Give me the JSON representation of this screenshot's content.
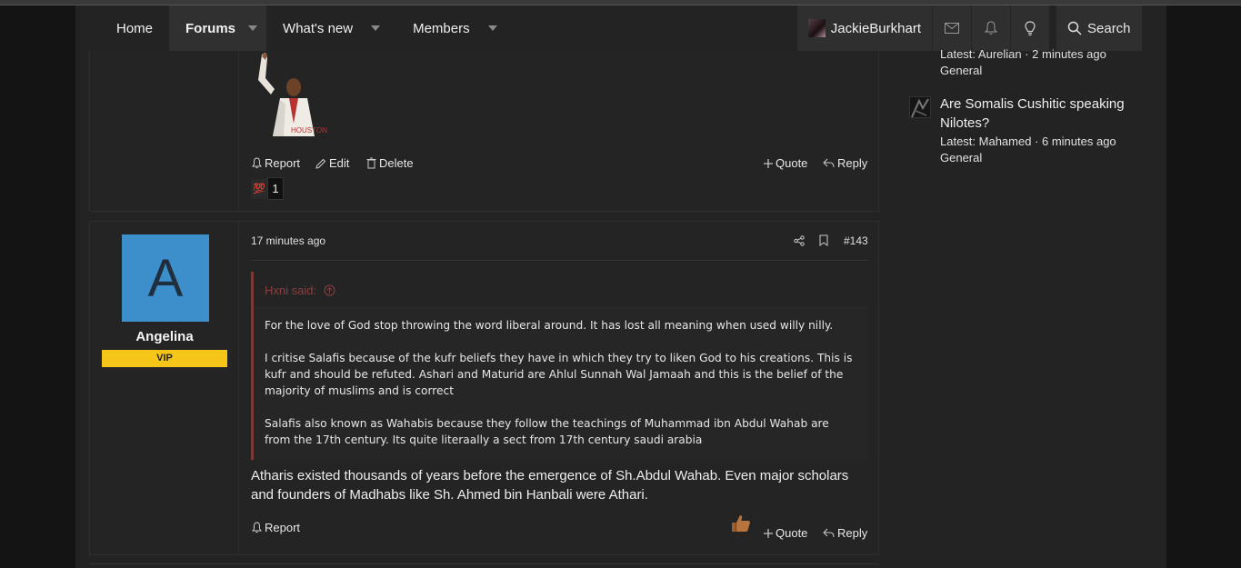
{
  "nav": {
    "home": "Home",
    "forums": "Forums",
    "whats_new": "What's new",
    "members": "Members",
    "username": "JackieBurkhart",
    "search": "Search"
  },
  "sidebar": {
    "thread1_meta": "Latest: Aurelian · 2 minutes ago",
    "thread1_forum": "General",
    "thread2_title": "Are Somalis Cushitic speaking Nilotes?",
    "thread2_meta": "Latest: Mahamed · 6 minutes ago",
    "thread2_forum": "General"
  },
  "post1": {
    "report": "Report",
    "edit": "Edit",
    "delete": "Delete",
    "quote": "Quote",
    "reply": "Reply",
    "reaction_emoji": "💯",
    "reaction_count": "1"
  },
  "post2": {
    "author_initial": "A",
    "author": "Angelina",
    "badge": "VIP",
    "time": "17 minutes ago",
    "number": "#143",
    "quote_author": "Hxni said:",
    "quote_paragraphs": [
      "For the love of God stop throwing the word liberal around. It has lost all meaning when used willy nilly.",
      "I critise Salafis because of the kufr beliefs they have in which they try to liken God to his creations. This is kufr and should be refuted. Ashari and Maturid are Ahlul Sunnah Wal Jamaah and this is the belief of the majority of muslims and is correct",
      "Salafis also known as Wahabis because they follow the teachings of Muhammad ibn Abdul Wahab are from the 17th century. Its quite literaally a sect from 17th century saudi arabia"
    ],
    "body": "Atharis existed thousands of years before the emergence of Sh.Abdul Wahab. Even major scholars and founders of Madhabs like Sh. Ahmed bin Hanbali were Athari.",
    "report": "Report",
    "quote": "Quote",
    "reply": "Reply"
  }
}
